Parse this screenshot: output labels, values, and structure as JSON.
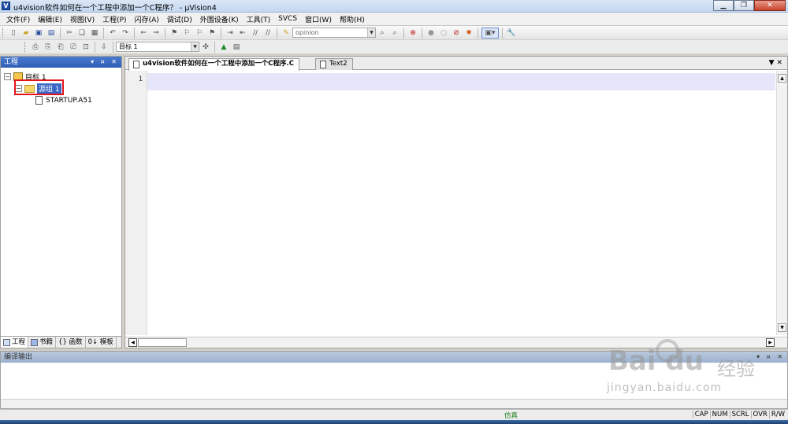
{
  "window": {
    "title": "u4vision软件如何在一个工程中添加一个C程序？ - µVision4",
    "app_icon": "V",
    "controls": [
      "minimize",
      "maximize",
      "close"
    ]
  },
  "menu": {
    "items": [
      "文件(F)",
      "编辑(E)",
      "视图(V)",
      "工程(P)",
      "闪存(A)",
      "调试(D)",
      "外围设备(K)",
      "工具(T)",
      "SVCS",
      "窗口(W)",
      "帮助(H)"
    ]
  },
  "toolbar": {
    "find_combo_value": "opinion",
    "target_combo_value": "目标 1"
  },
  "project_pane": {
    "title": "工程",
    "tree": {
      "target": "目标 1",
      "group": "源组 1",
      "file": "STARTUP.A51"
    },
    "tabs": [
      "工程",
      "书籍",
      "{} 函数",
      "0↓ 模板"
    ]
  },
  "editor": {
    "tabs": [
      "u4vision软件如何在一个工程中添加一个C程序.C",
      "Text2"
    ],
    "line_number": "1"
  },
  "build_output": {
    "title": "编译输出"
  },
  "statusbar": {
    "mode": "仿真",
    "flags": [
      "CAP",
      "NUM",
      "SCRL",
      "OVR",
      "R/W"
    ]
  },
  "watermark": {
    "logo": "Bai  du",
    "sub": "经验",
    "url": "jingyan.baidu.com"
  },
  "colors": {
    "pane_header": "#2f5fb4",
    "current_line": "#e6e6fa",
    "highlight_box": "#e3141b",
    "selection": "#3a66c5"
  }
}
